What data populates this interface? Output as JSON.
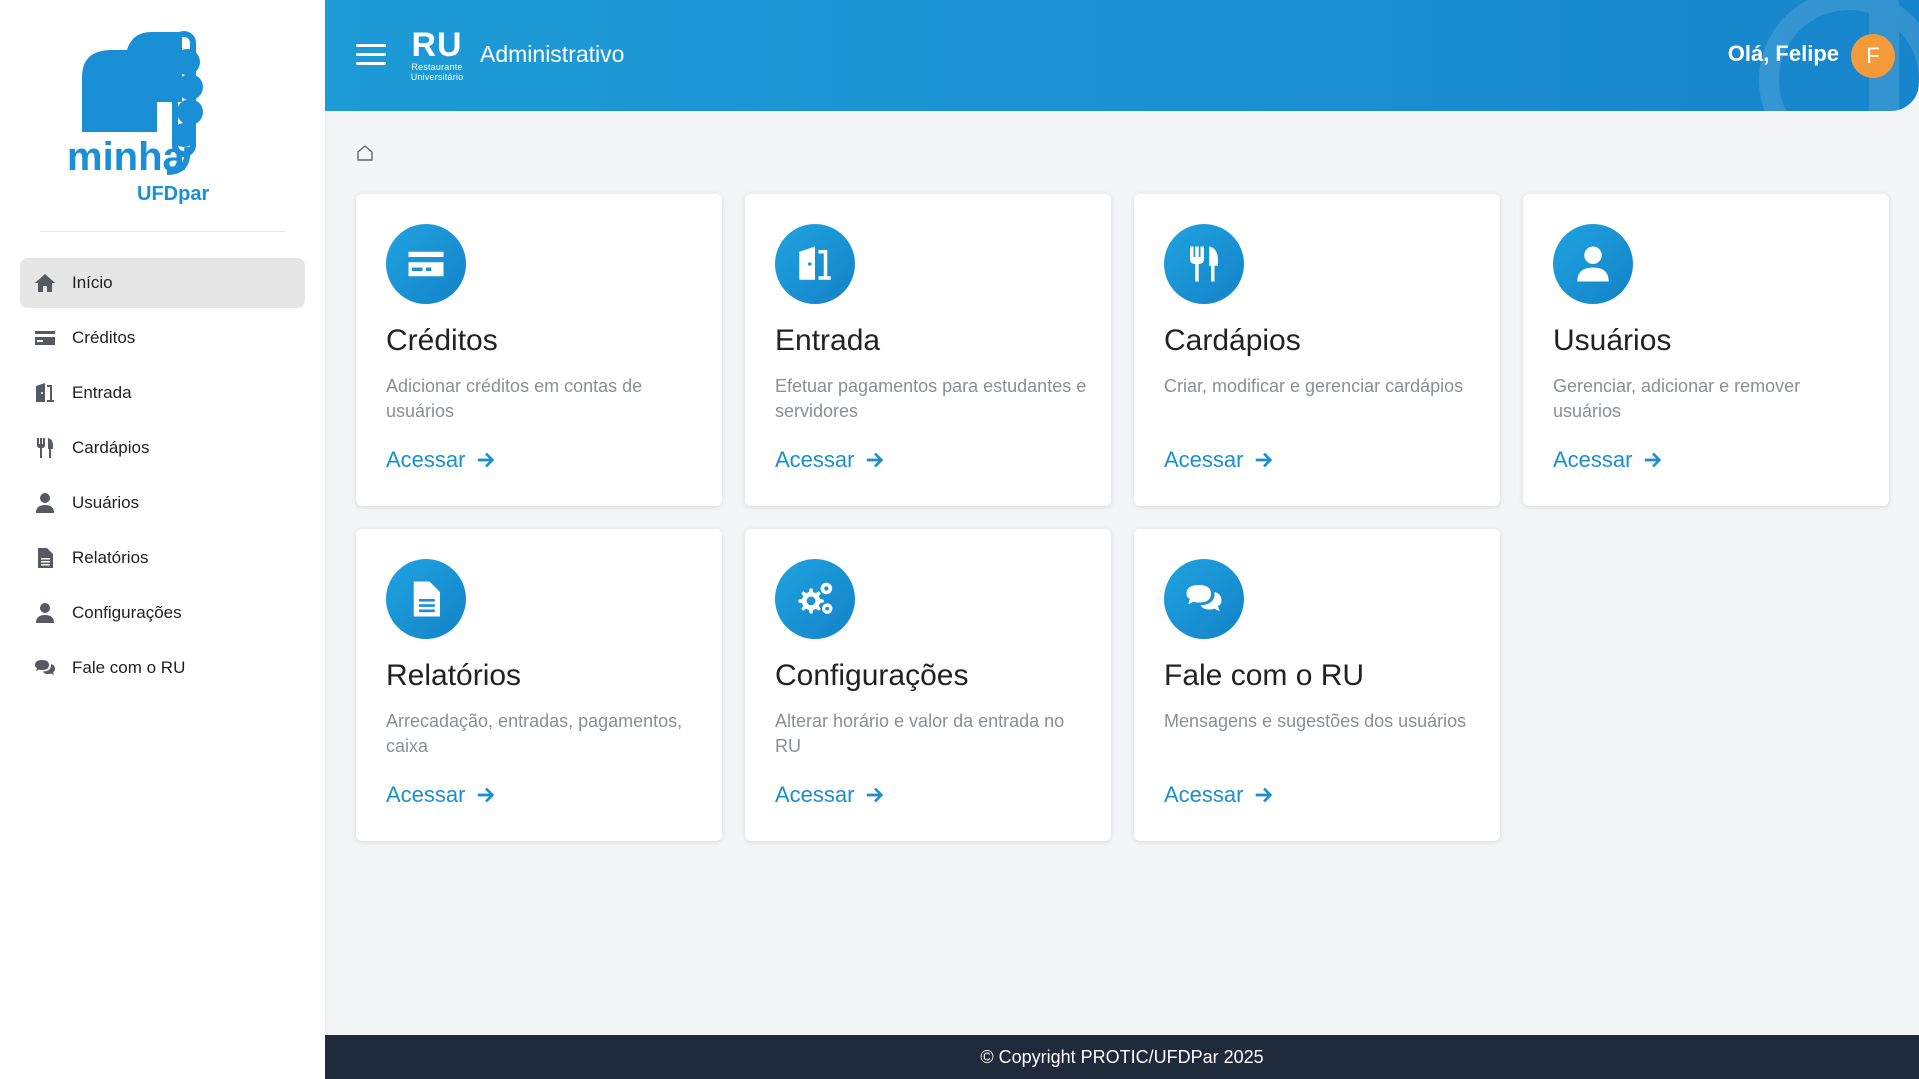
{
  "logo": {
    "text_main": "minha",
    "text_sub": "UFDpar"
  },
  "header": {
    "ru_title": "RU",
    "ru_subtitle_line1": "Restaurante",
    "ru_subtitle_line2": "Universitário",
    "title": "Administrativo",
    "greeting": "Olá, Felipe",
    "avatar_letter": "F"
  },
  "sidebar": {
    "items": [
      {
        "label": "Início",
        "icon": "home-icon",
        "active": true
      },
      {
        "label": "Créditos",
        "icon": "credit-card-icon"
      },
      {
        "label": "Entrada",
        "icon": "door-icon"
      },
      {
        "label": "Cardápios",
        "icon": "utensils-icon"
      },
      {
        "label": "Usuários",
        "icon": "user-icon"
      },
      {
        "label": "Relatórios",
        "icon": "document-icon"
      },
      {
        "label": "Configurações",
        "icon": "user-icon"
      },
      {
        "label": "Fale com o RU",
        "icon": "chat-icon"
      }
    ]
  },
  "cards": [
    {
      "title": "Créditos",
      "desc": "Adicionar créditos em contas de usuários",
      "link": "Acessar",
      "icon": "credit-card-icon"
    },
    {
      "title": "Entrada",
      "desc": "Efetuar pagamentos para estudantes e servidores",
      "link": "Acessar",
      "icon": "door-icon"
    },
    {
      "title": "Cardápios",
      "desc": "Criar, modificar e gerenciar cardápios",
      "link": "Acessar",
      "icon": "utensils-icon"
    },
    {
      "title": "Usuários",
      "desc": "Gerenciar, adicionar e remover usuários",
      "link": "Acessar",
      "icon": "user-icon"
    },
    {
      "title": "Relatórios",
      "desc": "Arrecadação, entradas, pagamentos, caixa",
      "link": "Acessar",
      "icon": "document-icon"
    },
    {
      "title": "Configurações",
      "desc": "Alterar horário e valor da entrada no RU",
      "link": "Acessar",
      "icon": "gears-icon"
    },
    {
      "title": "Fale com o RU",
      "desc": "Mensagens e sugestões dos usuários",
      "link": "Acessar",
      "icon": "chat-icon"
    }
  ],
  "footer": {
    "text": "© Copyright PROTIC/UFDPar 2025"
  },
  "colors": {
    "primary": "#1a8fd0",
    "avatar": "#f59a3b",
    "footer": "#1f2a3c"
  }
}
